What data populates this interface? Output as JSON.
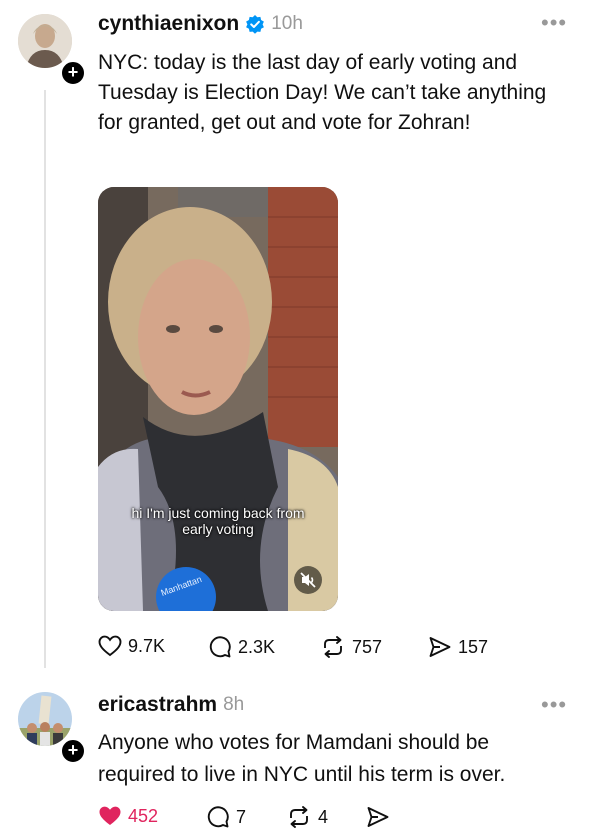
{
  "post": {
    "username": "cynthiaenixon",
    "verified": true,
    "time": "10h",
    "text": "NYC: today is the last day of early voting and Tuesday is Election Day!  We can’t take anything for granted, get out and vote for Zohran!",
    "video": {
      "caption_line1": "hi I'm just coming back from",
      "caption_line2": "early voting",
      "muted": true,
      "badge_text": "Manhattan"
    },
    "actions": {
      "likes": "9.7K",
      "replies": "2.3K",
      "reposts": "757",
      "shares": "157"
    }
  },
  "reply": {
    "username": "ericastrahm",
    "time": "8h",
    "text": "Anyone who votes for Mamdani should be required to live in NYC until his term is over.",
    "actions": {
      "likes": "452",
      "liked": true,
      "replies": "7",
      "reposts": "4"
    }
  },
  "colors": {
    "verified": "#0095f6",
    "like_active": "#e0245e",
    "muted_text": "#999999"
  }
}
